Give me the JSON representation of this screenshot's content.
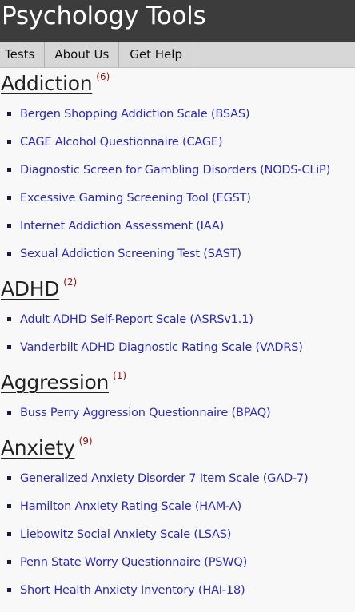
{
  "site": {
    "title": "Psychology Tools"
  },
  "nav": {
    "items": [
      "Tests",
      "About Us",
      "Get Help"
    ]
  },
  "sections": [
    {
      "title": "Addiction",
      "count": "(6)",
      "tests": [
        "Bergen Shopping Addiction Scale (BSAS)",
        "CAGE Alcohol Questionnaire (CAGE)",
        "Diagnostic Screen for Gambling Disorders (NODS-CLiP)",
        "Excessive Gaming Screening Tool (EGST)",
        "Internet Addiction Assessment (IAA)",
        "Sexual Addiction Screening Test (SAST)"
      ]
    },
    {
      "title": "ADHD",
      "count": "(2)",
      "tests": [
        "Adult ADHD Self-Report Scale (ASRSv1.1)",
        "Vanderbilt ADHD Diagnostic Rating Scale (VADRS)"
      ]
    },
    {
      "title": "Aggression",
      "count": "(1)",
      "tests": [
        "Buss Perry Aggression Questionnaire (BPAQ)"
      ]
    },
    {
      "title": "Anxiety",
      "count": "(9)",
      "tests": [
        "Generalized Anxiety Disorder 7 Item Scale (GAD-7)",
        "Hamilton Anxiety Rating Scale (HAM-A)",
        "Liebowitz Social Anxiety Scale (LSAS)",
        "Penn State Worry Questionnaire (PSWQ)",
        "Short Health Anxiety Inventory (HAI-18)"
      ]
    }
  ],
  "colors": {
    "header_bg": "#3c3c3c",
    "nav_bg": "#d7d7d7",
    "link": "#2b2bbf",
    "count": "#a01010"
  }
}
